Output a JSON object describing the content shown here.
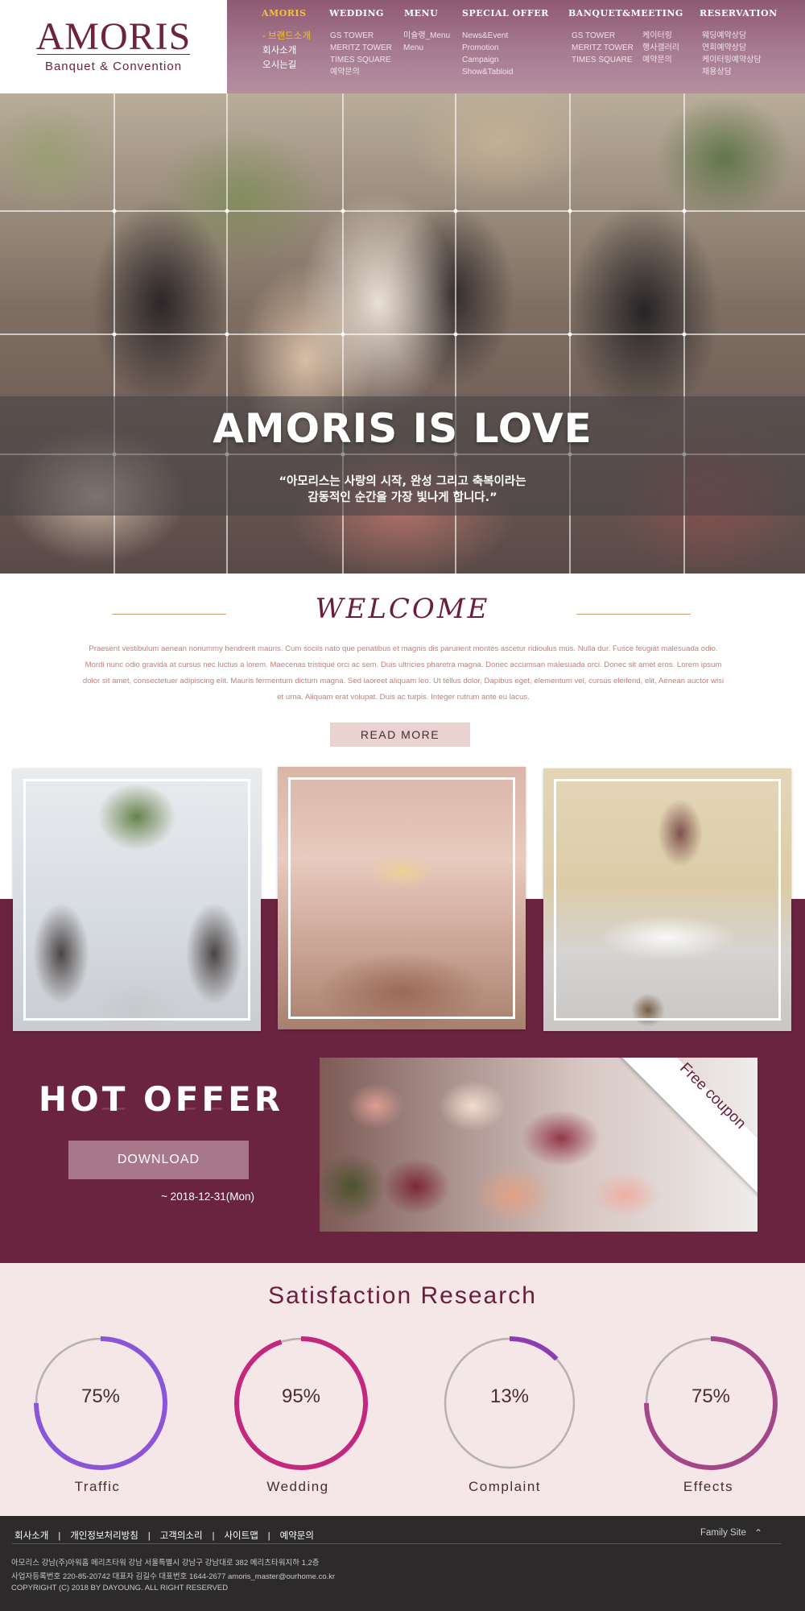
{
  "logo": {
    "wordmark": "AMORIS",
    "tagline": "Banquet & Convention"
  },
  "nav": {
    "items": [
      {
        "label": "AMORIS",
        "active": true,
        "sub": [
          "- 브랜드소개",
          "회사소개",
          "오시는길"
        ]
      },
      {
        "label": "WEDDING",
        "sub": [
          "GS TOWER",
          "MERITZ TOWER",
          "TIMES SQUARE",
          "예약문의"
        ]
      },
      {
        "label": "MENU",
        "sub": [
          "미슐랭_Menu",
          "Menu"
        ]
      },
      {
        "label": "SPECIAL OFFER",
        "sub": [
          "News&Event",
          "Promotion",
          "Campaign",
          "Show&Tabloid"
        ]
      },
      {
        "label": "BANQUET&MEETING",
        "sub": [
          "GS TOWER",
          "MERITZ TOWER",
          "TIMES SQUARE"
        ],
        "sub2": [
          "케이터링",
          "행사갤러리",
          "예약문의"
        ]
      },
      {
        "label": "RESERVATION",
        "sub": [
          "웨딩예약상담",
          "연회예약상담",
          "케이터링예약상담",
          "채용상담"
        ]
      }
    ]
  },
  "hero": {
    "title": "AMORIS IS LOVE",
    "subtitle_line1": "“아모리스는 사랑의 시작, 완성 그리고 축복이라는",
    "subtitle_line2": "감동적인 순간을 가장 빛나게 합니다.”"
  },
  "welcome": {
    "title": "WELCOME",
    "lines": [
      "Praesent vestibulum aenean nonummy hendrerit mauris. Cum sociis nato que penatibus et magnis dis parurient montes ascetur ridioulus mus. Nulla dur. Fusce feugiat malesuada odio.",
      "Mordi nunc odio gravida at cursus nec luctus a lorem. Maecenas tristique orci ac sem. Duis ultricies pharetra magna. Donec accumsan malesuada orci. Donec sit amet eros. Lorem ipsum",
      "dolor sit amet, consectetuer adipiscing elit. Mauris fermentum dictum magna. Sed laoreet aliquam leo. Ut tellus dolor, Dapibus eget, elementum vel, cursus eleifend, elit, Aenean auctor wisi",
      "et urna. Aliquam erat volupat. Duis ac turpis. Integer rutrum ante eu lacus."
    ],
    "read_more": "READ MORE"
  },
  "hot_offer": {
    "title": "HOT OFFER",
    "download": "DOWNLOAD",
    "deadline": "~ 2018-12-31(Mon)",
    "coupon_label": "Free coupon"
  },
  "satisfaction": {
    "title": "Satisfaction Research",
    "items": [
      {
        "label": "Traffic",
        "percent": 75,
        "pct_text": "75%",
        "color": "#8b55d9",
        "start_deg": 0
      },
      {
        "label": "Wedding",
        "percent": 95,
        "pct_text": "95%",
        "color": "#c3277e",
        "start_deg": 0
      },
      {
        "label": "Complaint",
        "percent": 13,
        "pct_text": "13%",
        "color": "#8b3eb3",
        "start_deg": 0
      },
      {
        "label": "Effects",
        "percent": 75,
        "pct_text": "75%",
        "color": "#a3478a",
        "start_deg": 0
      }
    ],
    "track_color": "#b5b1b1"
  },
  "footer": {
    "links": [
      "회사소개",
      "개인정보처리방침",
      "고객의소리",
      "사이트맵",
      "예약문의"
    ],
    "family_site": "Family Site",
    "info_line1": "아모리스 강남(주)아워홈 메리츠타워 강남 서울특별시 강남구 강남대로 382 메리츠타워지하 1,2층",
    "info_line2": "사업자등록번호 220-85-20742 대표자 김길수 대표번호 1644-2677 amoris_master@ourhome.co.kr",
    "copyright": "COPYRIGHT (C) 2018 BY DAYOUNG. ALL RIGHT RESERVED"
  }
}
